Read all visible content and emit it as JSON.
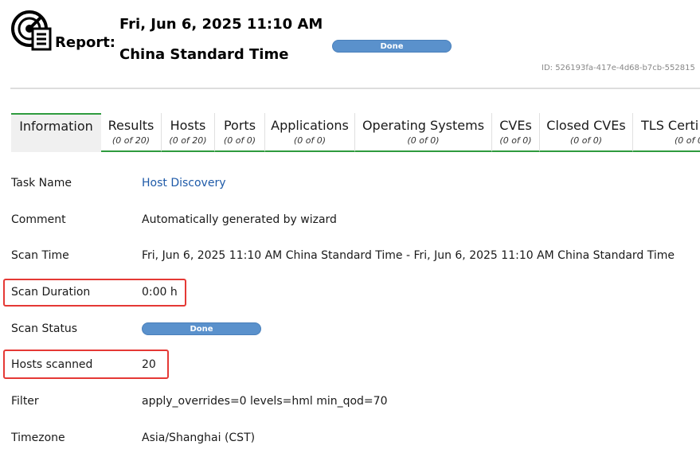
{
  "header": {
    "report_label": "Report:",
    "datetime": "Fri, Jun 6, 2025 11:10 AM",
    "timezone": "China Standard Time",
    "status": "Done",
    "report_id": "ID: 526193fa-417e-4d68-b7cb-552815"
  },
  "tabs": [
    {
      "name": "Information",
      "count": ""
    },
    {
      "name": "Results",
      "count": "(0 of 20)"
    },
    {
      "name": "Hosts",
      "count": "(0 of 20)"
    },
    {
      "name": "Ports",
      "count": "(0 of 0)"
    },
    {
      "name": "Applications",
      "count": "(0 of 0)"
    },
    {
      "name": "Operating Systems",
      "count": "(0 of 0)"
    },
    {
      "name": "CVEs",
      "count": "(0 of 0)"
    },
    {
      "name": "Closed CVEs",
      "count": "(0 of 0)"
    },
    {
      "name": "TLS Certi",
      "count": "(0 of 0"
    }
  ],
  "details": {
    "task_name_label": "Task Name",
    "task_name_value": "Host Discovery",
    "comment_label": "Comment",
    "comment_value": "Automatically generated by wizard",
    "scan_time_label": "Scan Time",
    "scan_time_value": "Fri, Jun 6, 2025 11:10 AM China Standard Time - Fri, Jun 6, 2025 11:10 AM China Standard Time",
    "scan_duration_label": "Scan Duration",
    "scan_duration_value": "0:00 h",
    "scan_status_label": "Scan Status",
    "scan_status_value": "Done",
    "hosts_scanned_label": "Hosts scanned",
    "hosts_scanned_value": "20",
    "filter_label": "Filter",
    "filter_value": "apply_overrides=0 levels=hml min_qod=70",
    "timezone_label": "Timezone",
    "timezone_value": "Asia/Shanghai (CST)"
  },
  "colors": {
    "accent_green": "#2e9b3e",
    "status_blue": "#5a91cc",
    "highlight_red": "#e53935",
    "link_blue": "#1e5aa8"
  },
  "icons": {
    "report": "report-radar-icon"
  }
}
